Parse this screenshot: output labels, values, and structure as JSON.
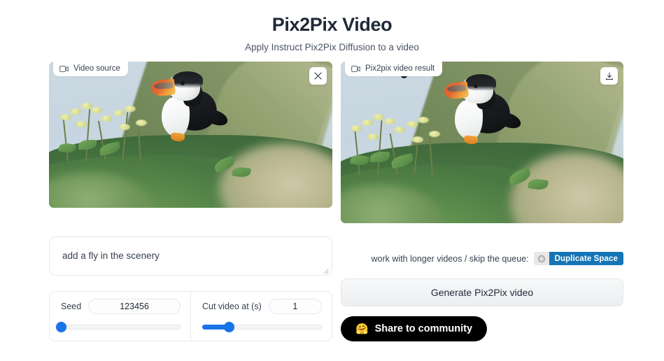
{
  "header": {
    "title": "Pix2Pix Video",
    "subtitle": "Apply Instruct Pix2Pix Diffusion to a video"
  },
  "source_panel": {
    "label": "Video source",
    "label_icon": "video-camera-icon",
    "clear_icon": "close-icon",
    "media_description": "Atlantic puffin standing on a grassy coastal cliff with pale yellow-green flowering plants and a soft blue sky"
  },
  "result_panel": {
    "label": "Pix2pix video result",
    "label_icon": "video-camera-icon",
    "download_icon": "download-icon",
    "media_description": "Same puffin scene with a small black fly added in the sky at upper left"
  },
  "prompt": {
    "value": "add a fly in the scenery",
    "placeholder": "add a fly in the scenery"
  },
  "controls": {
    "seed": {
      "label": "Seed",
      "value": "123456",
      "slider_percent": 0,
      "fill_percent": 0
    },
    "cut": {
      "label": "Cut video at (s)",
      "value": "1",
      "slider_percent": 22,
      "fill_percent": 22
    }
  },
  "duplicate": {
    "text": "work with longer videos / skip the queue:",
    "button_label": "Duplicate Space",
    "button_icon": "hf-logo-icon",
    "button_color": "#1574b5"
  },
  "generate": {
    "label": "Generate Pix2Pix video"
  },
  "share": {
    "emoji": "🤗",
    "label": "Share to community",
    "background": "#000000"
  },
  "colors": {
    "accent": "#1773ea",
    "page_bg": "#ffffff",
    "text": "#374151"
  }
}
